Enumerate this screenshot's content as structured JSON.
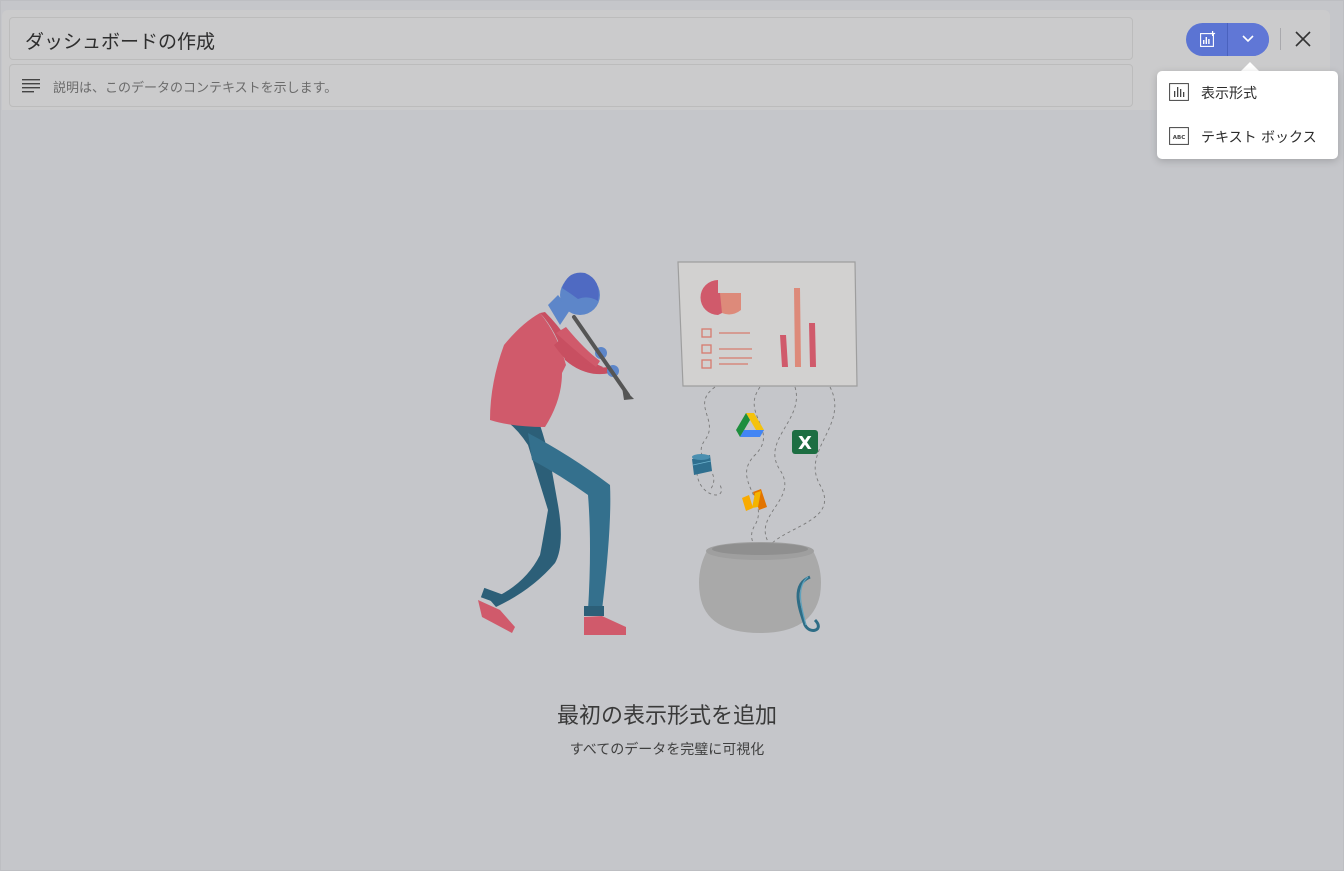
{
  "header": {
    "title": "ダッシュボードの作成",
    "description_placeholder": "説明は、このデータのコンテキストを示します。"
  },
  "toolbar": {
    "add_visualization_icon": "add-chart-icon",
    "dropdown_icon": "chevron-down-icon",
    "close_icon": "close-icon"
  },
  "menu": {
    "items": [
      {
        "label": "表示形式",
        "icon": "bar-chart-icon"
      },
      {
        "label": "テキスト ボックス",
        "icon": "text-box-icon"
      }
    ]
  },
  "empty_state": {
    "title": "最初の表示形式を追加",
    "subtitle": "すべてのデータを完璧に可視化"
  },
  "colors": {
    "accent": "#5b74d3",
    "background": "#c4c5c9",
    "menu_background": "#ffffff"
  }
}
